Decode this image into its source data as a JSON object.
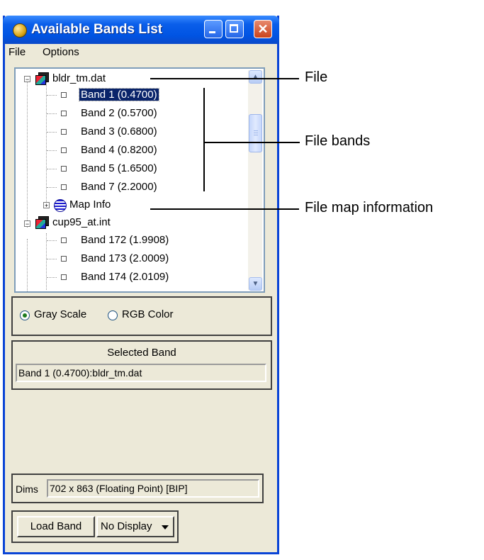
{
  "window": {
    "title": "Available Bands List"
  },
  "menu": [
    "File",
    "Options"
  ],
  "tree": {
    "files": [
      {
        "name": "bldr_tm.dat",
        "bands": [
          "Band 1 (0.4700)",
          "Band 2 (0.5700)",
          "Band 3 (0.6800)",
          "Band 4 (0.8200)",
          "Band 5 (1.6500)",
          "Band 7 (2.2000)"
        ],
        "map_info": "Map Info"
      },
      {
        "name": "cup95_at.int",
        "bands": [
          "Band 172 (1.9908)",
          "Band 173 (2.0009)",
          "Band 174 (2.0109)"
        ]
      }
    ]
  },
  "radio": {
    "gray": "Gray Scale",
    "rgb": "RGB Color",
    "selected": "Gray Scale"
  },
  "selected_band": {
    "title": "Selected Band",
    "value": "Band 1 (0.4700):bldr_tm.dat"
  },
  "dims": {
    "label": "Dims",
    "value": "702 x 863 (Floating Point) [BIP]"
  },
  "buttons": {
    "load": "Load Band",
    "display": "No Display"
  },
  "annotations": {
    "file": "File",
    "file_bands": "File bands",
    "file_map": "File map information"
  },
  "icons": [
    "app-globe-icon",
    "minimize-icon",
    "maximize-icon",
    "close-icon",
    "file-stack-icon",
    "globe-icon",
    "scroll-up-icon",
    "scroll-down-icon",
    "dropdown-caret-icon"
  ]
}
